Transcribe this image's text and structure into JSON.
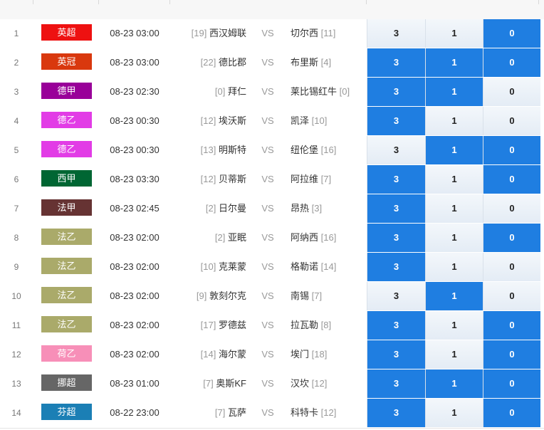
{
  "colors": {
    "selected_cell": "#1f7ee1",
    "unselected_cell": "#eaf0f7"
  },
  "vs_label": "VS",
  "matches": [
    {
      "index": "1",
      "league": "英超",
      "league_color": "#ee1111",
      "time": "08-23 03:00",
      "home_rank": "[19]",
      "home": "西汉姆联",
      "away": "切尔西",
      "away_rank": "[11]",
      "odds": [
        {
          "value": "3",
          "selected": false
        },
        {
          "value": "1",
          "selected": false
        },
        {
          "value": "0",
          "selected": true
        }
      ]
    },
    {
      "index": "2",
      "league": "英冠",
      "league_color": "#d9380e",
      "time": "08-23 03:00",
      "home_rank": "[22]",
      "home": "德比郡",
      "away": "布里斯",
      "away_rank": "[4]",
      "odds": [
        {
          "value": "3",
          "selected": true
        },
        {
          "value": "1",
          "selected": true
        },
        {
          "value": "0",
          "selected": true
        }
      ]
    },
    {
      "index": "3",
      "league": "德甲",
      "league_color": "#990099",
      "time": "08-23 02:30",
      "home_rank": "[0]",
      "home": "拜仁",
      "away": "莱比锡红牛",
      "away_rank": "[0]",
      "odds": [
        {
          "value": "3",
          "selected": true
        },
        {
          "value": "1",
          "selected": true
        },
        {
          "value": "0",
          "selected": false
        }
      ]
    },
    {
      "index": "4",
      "league": "德乙",
      "league_color": "#e23ce6",
      "time": "08-23 00:30",
      "home_rank": "[12]",
      "home": "埃沃斯",
      "away": "凯泽",
      "away_rank": "[10]",
      "odds": [
        {
          "value": "3",
          "selected": true
        },
        {
          "value": "1",
          "selected": false
        },
        {
          "value": "0",
          "selected": false
        }
      ]
    },
    {
      "index": "5",
      "league": "德乙",
      "league_color": "#e23ce6",
      "time": "08-23 00:30",
      "home_rank": "[13]",
      "home": "明斯特",
      "away": "纽伦堡",
      "away_rank": "[16]",
      "odds": [
        {
          "value": "3",
          "selected": false
        },
        {
          "value": "1",
          "selected": true
        },
        {
          "value": "0",
          "selected": true
        }
      ]
    },
    {
      "index": "6",
      "league": "西甲",
      "league_color": "#006633",
      "time": "08-23 03:30",
      "home_rank": "[12]",
      "home": "贝蒂斯",
      "away": "阿拉维",
      "away_rank": "[7]",
      "odds": [
        {
          "value": "3",
          "selected": true
        },
        {
          "value": "1",
          "selected": false
        },
        {
          "value": "0",
          "selected": true
        }
      ]
    },
    {
      "index": "7",
      "league": "法甲",
      "league_color": "#663333",
      "time": "08-23 02:45",
      "home_rank": "[2]",
      "home": "日尔曼",
      "away": "昂热",
      "away_rank": "[3]",
      "odds": [
        {
          "value": "3",
          "selected": true
        },
        {
          "value": "1",
          "selected": false
        },
        {
          "value": "0",
          "selected": false
        }
      ]
    },
    {
      "index": "8",
      "league": "法乙",
      "league_color": "#aaaa6a",
      "time": "08-23 02:00",
      "home_rank": "[2]",
      "home": "亚眠",
      "away": "阿纳西",
      "away_rank": "[16]",
      "odds": [
        {
          "value": "3",
          "selected": true
        },
        {
          "value": "1",
          "selected": false
        },
        {
          "value": "0",
          "selected": true
        }
      ]
    },
    {
      "index": "9",
      "league": "法乙",
      "league_color": "#aaaa6a",
      "time": "08-23 02:00",
      "home_rank": "[10]",
      "home": "克莱蒙",
      "away": "格勒诺",
      "away_rank": "[14]",
      "odds": [
        {
          "value": "3",
          "selected": true
        },
        {
          "value": "1",
          "selected": false
        },
        {
          "value": "0",
          "selected": false
        }
      ]
    },
    {
      "index": "10",
      "league": "法乙",
      "league_color": "#aaaa6a",
      "time": "08-23 02:00",
      "home_rank": "[9]",
      "home": "敦刻尔克",
      "away": "南锡",
      "away_rank": "[7]",
      "odds": [
        {
          "value": "3",
          "selected": false
        },
        {
          "value": "1",
          "selected": true
        },
        {
          "value": "0",
          "selected": false
        }
      ]
    },
    {
      "index": "11",
      "league": "法乙",
      "league_color": "#aaaa6a",
      "time": "08-23 02:00",
      "home_rank": "[17]",
      "home": "罗德兹",
      "away": "拉瓦勒",
      "away_rank": "[8]",
      "odds": [
        {
          "value": "3",
          "selected": true
        },
        {
          "value": "1",
          "selected": false
        },
        {
          "value": "0",
          "selected": true
        }
      ]
    },
    {
      "index": "12",
      "league": "荷乙",
      "league_color": "#f78fb8",
      "time": "08-23 02:00",
      "home_rank": "[14]",
      "home": "海尔蒙",
      "away": "埃门",
      "away_rank": "[18]",
      "odds": [
        {
          "value": "3",
          "selected": true
        },
        {
          "value": "1",
          "selected": false
        },
        {
          "value": "0",
          "selected": true
        }
      ]
    },
    {
      "index": "13",
      "league": "挪超",
      "league_color": "#666666",
      "time": "08-23 01:00",
      "home_rank": "[7]",
      "home": "奥斯KF",
      "away": "汉坎",
      "away_rank": "[12]",
      "odds": [
        {
          "value": "3",
          "selected": true
        },
        {
          "value": "1",
          "selected": true
        },
        {
          "value": "0",
          "selected": true
        }
      ]
    },
    {
      "index": "14",
      "league": "芬超",
      "league_color": "#1b7fb5",
      "time": "08-22 23:00",
      "home_rank": "[7]",
      "home": "瓦萨",
      "away": "科特卡",
      "away_rank": "[12]",
      "odds": [
        {
          "value": "3",
          "selected": true
        },
        {
          "value": "1",
          "selected": false
        },
        {
          "value": "0",
          "selected": true
        }
      ]
    }
  ]
}
